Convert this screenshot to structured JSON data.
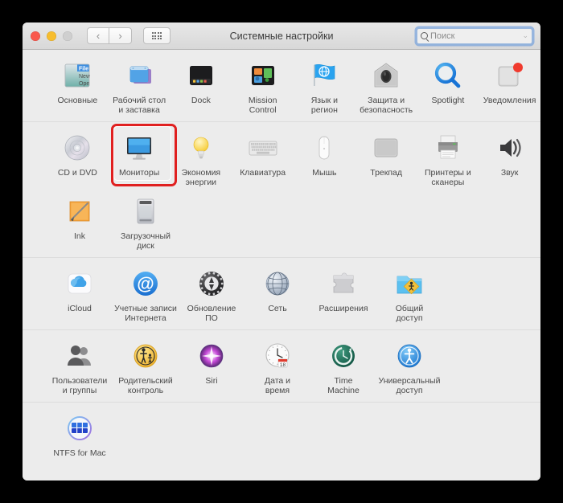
{
  "window": {
    "title": "Системные настройки",
    "traffic_lights": [
      "close",
      "minimize",
      "zoom"
    ],
    "nav_back": "‹",
    "nav_forward": "›",
    "grid_button": "show-all-grid"
  },
  "search": {
    "placeholder": "Поиск",
    "value": "",
    "icon": "search-icon",
    "focus_ring_color": "#588fdd"
  },
  "highlight": {
    "target": "Мониторы",
    "color": "#e02020"
  },
  "sections": [
    {
      "id": "personal",
      "items": [
        {
          "label": "Основные",
          "icon": "general-icon"
        },
        {
          "label": "Рабочий стол\nи заставка",
          "icon": "desktop-screensaver-icon"
        },
        {
          "label": "Dock",
          "icon": "dock-icon"
        },
        {
          "label": "Mission\nControl",
          "icon": "mission-control-icon"
        },
        {
          "label": "Язык и\nрегион",
          "icon": "language-region-icon"
        },
        {
          "label": "Защита и\nбезопасность",
          "icon": "security-privacy-icon"
        },
        {
          "label": "Spotlight",
          "icon": "spotlight-icon"
        },
        {
          "label": "Уведомления",
          "icon": "notifications-icon"
        }
      ]
    },
    {
      "id": "hardware",
      "items": [
        {
          "label": "CD и DVD",
          "icon": "cd-dvd-icon"
        },
        {
          "label": "Мониторы",
          "icon": "displays-icon",
          "highlighted": true
        },
        {
          "label": "Экономия\nэнергии",
          "icon": "energy-saver-icon"
        },
        {
          "label": "Клавиатура",
          "icon": "keyboard-icon"
        },
        {
          "label": "Мышь",
          "icon": "mouse-icon"
        },
        {
          "label": "Трекпад",
          "icon": "trackpad-icon"
        },
        {
          "label": "Принтеры и\nсканеры",
          "icon": "printers-scanners-icon"
        },
        {
          "label": "Звук",
          "icon": "sound-icon"
        }
      ],
      "items2": [
        {
          "label": "Ink",
          "icon": "ink-icon"
        },
        {
          "label": "Загрузочный\nдиск",
          "icon": "startup-disk-icon"
        }
      ]
    },
    {
      "id": "internet",
      "items": [
        {
          "label": "iCloud",
          "icon": "icloud-icon"
        },
        {
          "label": "Учетные записи\nИнтернета",
          "icon": "internet-accounts-icon"
        },
        {
          "label": "Обновление\nПО",
          "icon": "software-update-icon"
        },
        {
          "label": "Сеть",
          "icon": "network-icon"
        },
        {
          "label": "Расширения",
          "icon": "extensions-icon"
        },
        {
          "label": "Общий\nдоступ",
          "icon": "sharing-icon"
        }
      ]
    },
    {
      "id": "system",
      "items": [
        {
          "label": "Пользователи\nи группы",
          "icon": "users-groups-icon"
        },
        {
          "label": "Родительский\nконтроль",
          "icon": "parental-controls-icon"
        },
        {
          "label": "Siri",
          "icon": "siri-icon"
        },
        {
          "label": "Дата и\nвремя",
          "icon": "date-time-icon"
        },
        {
          "label": "Time\nMachine",
          "icon": "time-machine-icon"
        },
        {
          "label": "Универсальный\nдоступ",
          "icon": "accessibility-icon"
        }
      ]
    },
    {
      "id": "other",
      "items": [
        {
          "label": "NTFS for Mac",
          "icon": "ntfs-for-mac-icon"
        }
      ]
    }
  ]
}
